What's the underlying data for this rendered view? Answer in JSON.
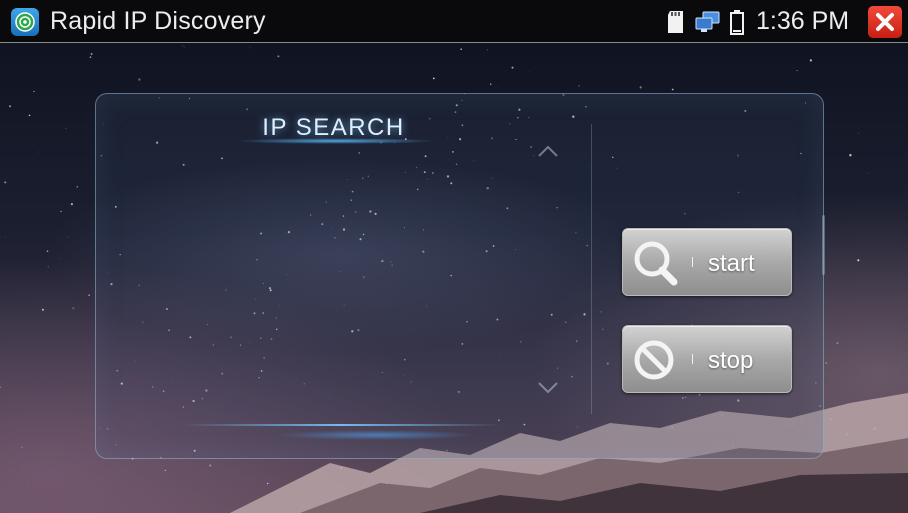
{
  "titlebar": {
    "app_title": "Rapid IP Discovery",
    "clock": "1:36 PM",
    "icons": {
      "app": "app-logo-icon",
      "sd": "sd-card-icon",
      "network": "network-icon",
      "battery": "battery-icon",
      "close": "close-icon"
    },
    "colors": {
      "close": "#d9281a",
      "app_icon": "#2f8fd8"
    }
  },
  "panel": {
    "title": "IP SEARCH",
    "buttons": {
      "start": {
        "label": "start",
        "icon": "search-icon"
      },
      "stop": {
        "label": "stop",
        "icon": "stop-icon"
      }
    },
    "scroll": {
      "up": "chevron-up-icon",
      "down": "chevron-down-icon"
    }
  }
}
